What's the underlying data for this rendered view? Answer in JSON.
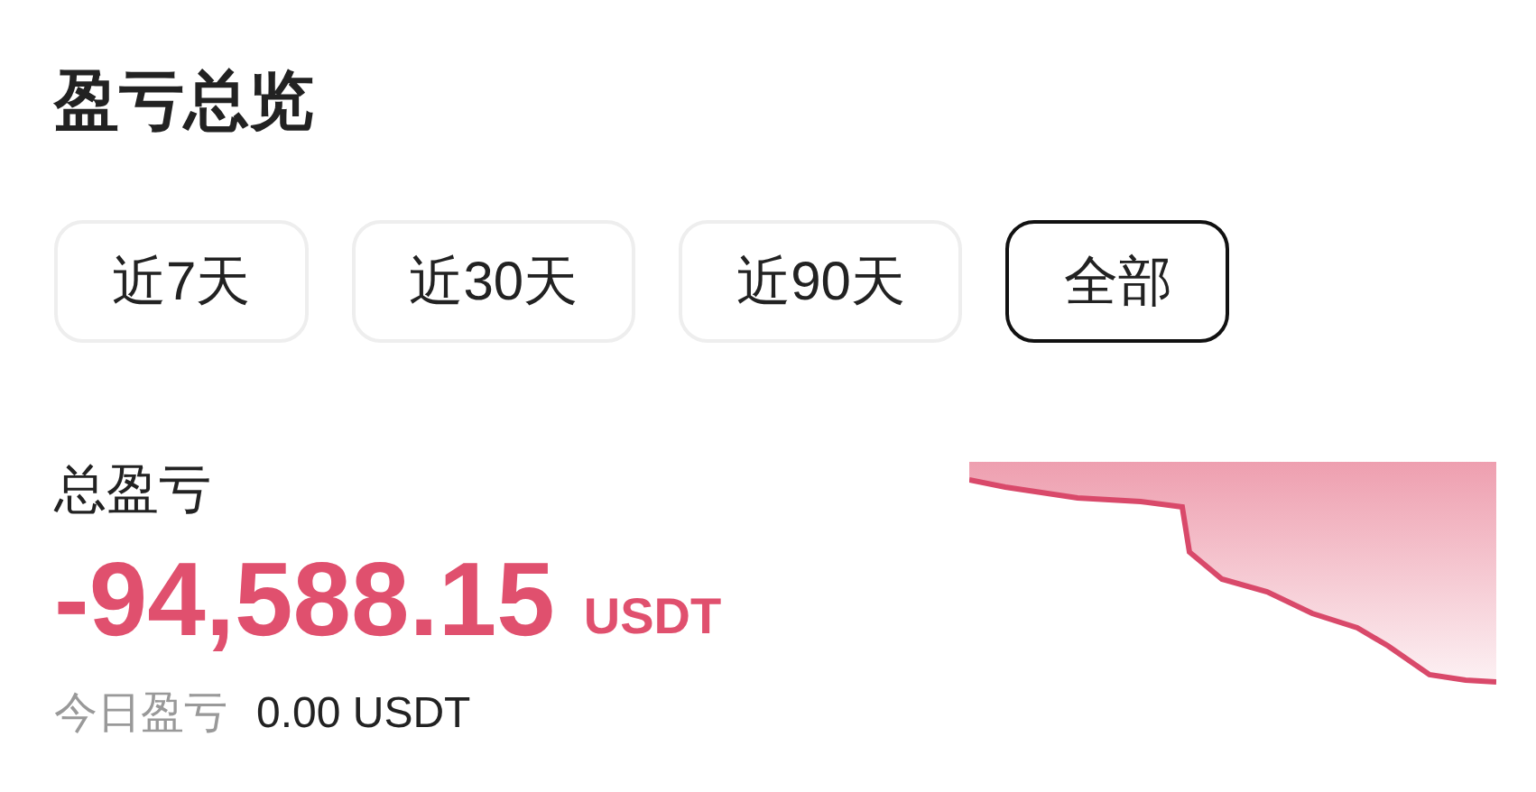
{
  "title": "盈亏总览",
  "tabs": [
    {
      "label": "近7天",
      "selected": false
    },
    {
      "label": "近30天",
      "selected": false
    },
    {
      "label": "近90天",
      "selected": false
    },
    {
      "label": "全部",
      "selected": true
    }
  ],
  "total": {
    "label": "总盈亏",
    "value": "-94,588.15",
    "unit": "USDT"
  },
  "today": {
    "label": "今日盈亏",
    "value": "0.00 USDT"
  }
}
